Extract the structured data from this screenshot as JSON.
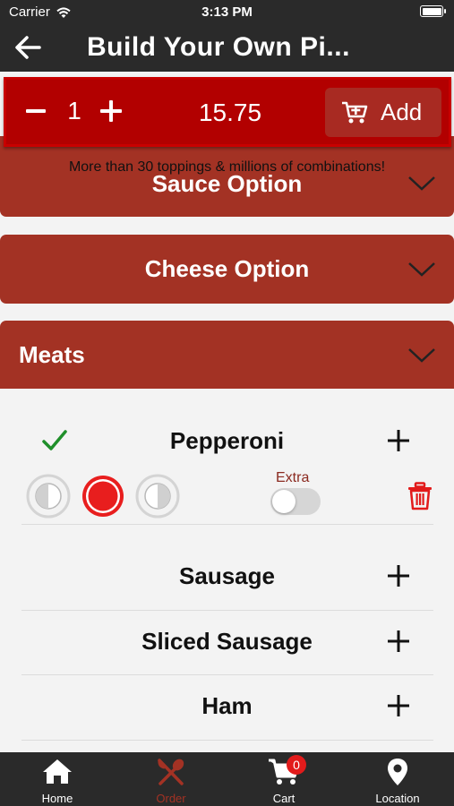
{
  "status_bar": {
    "carrier": "Carrier",
    "time": "3:13 PM"
  },
  "nav": {
    "title": "Build Your Own Pi..."
  },
  "action_bar": {
    "quantity": "1",
    "price": "15.75",
    "add_label": "Add"
  },
  "tagline": "More than 30 toppings & millions of combinations!",
  "sections": {
    "sauce": "Sauce Option",
    "cheese": "Cheese Option",
    "meats": "Meats"
  },
  "meats": {
    "selected": {
      "name": "Pepperoni",
      "extra_label": "Extra",
      "extra_on": false,
      "portion": "whole"
    },
    "items": [
      "Sausage",
      "Sliced Sausage",
      "Ham"
    ]
  },
  "tabs": [
    {
      "label": "Home",
      "icon": "home-icon"
    },
    {
      "label": "Order",
      "icon": "utensils-icon"
    },
    {
      "label": "Cart",
      "icon": "cart-icon"
    },
    {
      "label": "Location",
      "icon": "location-pin-icon"
    }
  ],
  "cart_count": "0",
  "colors": {
    "brand_red": "#b20000",
    "section_red": "#a33224",
    "dark_bar": "#2a2a2a",
    "check_green": "#1f8f2a",
    "active_tab": "#a33224"
  }
}
